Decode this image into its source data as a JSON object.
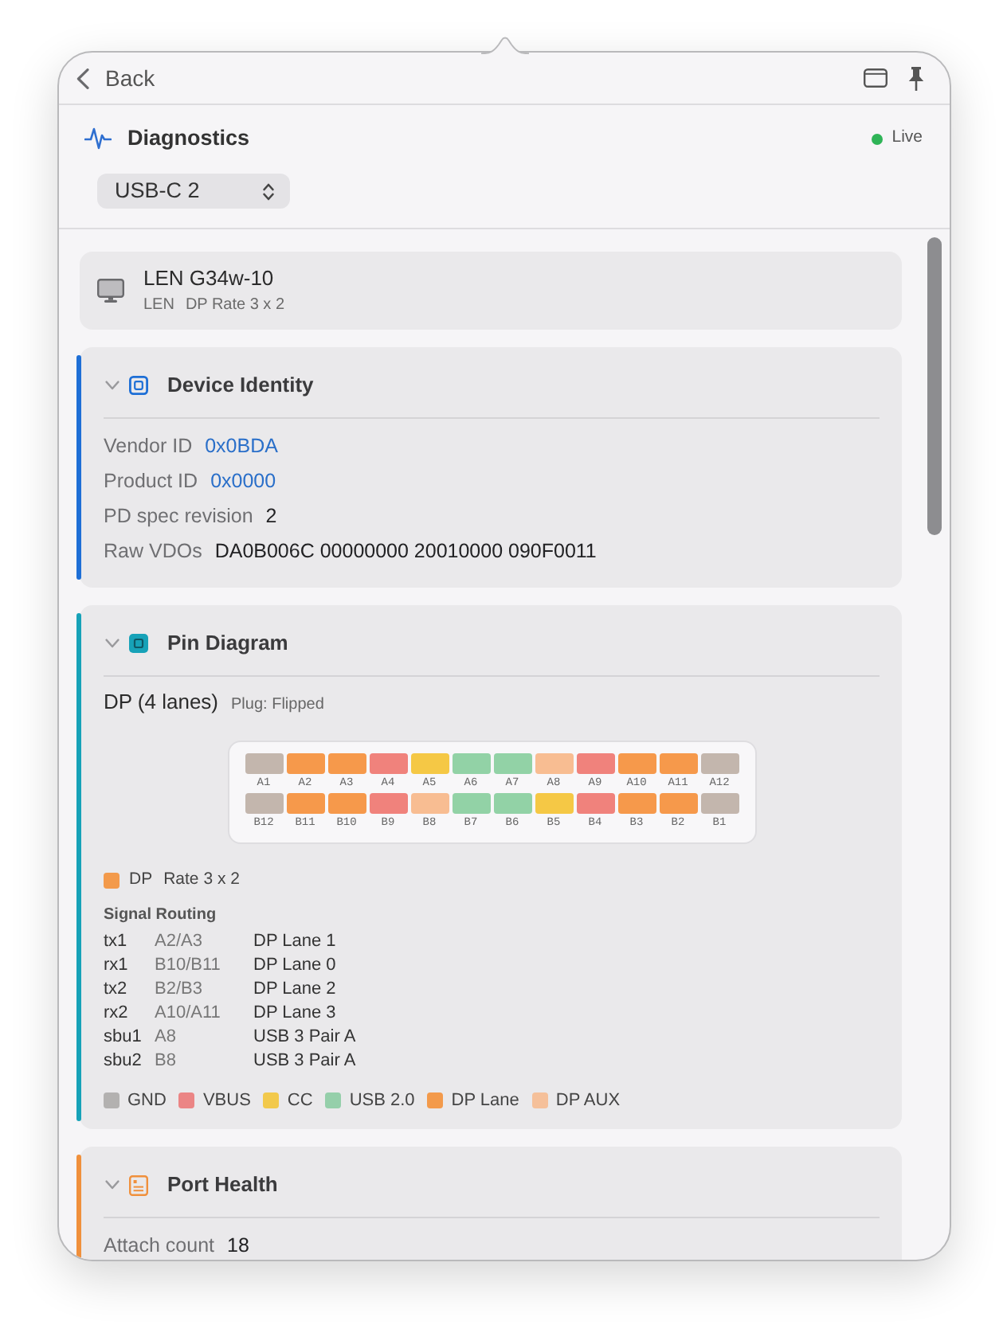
{
  "header": {
    "back_label": "Back"
  },
  "title": "Diagnostics",
  "status": {
    "label": "Live",
    "on": true
  },
  "port_select": {
    "value": "USB-C 2"
  },
  "device": {
    "name": "LEN G34w-10",
    "vendor": "LEN",
    "mode": "DP Rate 3 x 2"
  },
  "sections": [
    {
      "kind": "identity",
      "title": "Device Identity",
      "color": "#1e6fd6",
      "expanded": true,
      "fields": [
        {
          "label": "Vendor ID",
          "value": "0x0BDA",
          "kind": "id"
        },
        {
          "label": "Product ID",
          "value": "0x0000",
          "kind": "id"
        },
        {
          "label": "PD spec revision",
          "value": "2",
          "kind": "plain"
        },
        {
          "label": "Raw VDOs",
          "value": "DA0B006C 00000000 20010000 090F0011",
          "kind": "plain"
        }
      ]
    },
    {
      "kind": "pins",
      "title": "Pin Diagram",
      "color": "#17a2b8",
      "expanded": true,
      "mode": "DP (4 lanes)",
      "plug": "Plug: Flipped",
      "pins_top": [
        {
          "label": "A1",
          "color": "#c3b6ad"
        },
        {
          "label": "A2",
          "color": "#f6994b"
        },
        {
          "label": "A3",
          "color": "#f6994b"
        },
        {
          "label": "A4",
          "color": "#f0827c"
        },
        {
          "label": "A5",
          "color": "#f5c845"
        },
        {
          "label": "A6",
          "color": "#92d2a6"
        },
        {
          "label": "A7",
          "color": "#92d2a6"
        },
        {
          "label": "A8",
          "color": "#f8bd92"
        },
        {
          "label": "A9",
          "color": "#f0827c"
        },
        {
          "label": "A10",
          "color": "#f6994b"
        },
        {
          "label": "A11",
          "color": "#f6994b"
        },
        {
          "label": "A12",
          "color": "#c3b6ad"
        }
      ],
      "pins_bottom": [
        {
          "label": "B12",
          "color": "#c3b6ad"
        },
        {
          "label": "B11",
          "color": "#f6994b"
        },
        {
          "label": "B10",
          "color": "#f6994b"
        },
        {
          "label": "B9",
          "color": "#f0827c"
        },
        {
          "label": "B8",
          "color": "#f8bd92"
        },
        {
          "label": "B7",
          "color": "#92d2a6"
        },
        {
          "label": "B6",
          "color": "#92d2a6"
        },
        {
          "label": "B5",
          "color": "#f5c845"
        },
        {
          "label": "B4",
          "color": "#f0827c"
        },
        {
          "label": "B3",
          "color": "#f6994b"
        },
        {
          "label": "B2",
          "color": "#f6994b"
        },
        {
          "label": "B1",
          "color": "#c3b6ad"
        }
      ],
      "mode_key": {
        "color": "#f39a4b",
        "label": "DP",
        "detail": "Rate 3 x 2"
      },
      "routing_title": "Signal Routing",
      "routing": [
        {
          "signal": "tx1",
          "pins": "A2/A3",
          "function": "DP Lane 1"
        },
        {
          "signal": "rx1",
          "pins": "B10/B11",
          "function": "DP Lane 0"
        },
        {
          "signal": "tx2",
          "pins": "B2/B3",
          "function": "DP Lane 2"
        },
        {
          "signal": "rx2",
          "pins": "A10/A11",
          "function": "DP Lane 3"
        },
        {
          "signal": "sbu1",
          "pins": "A8",
          "function": "USB 3 Pair A"
        },
        {
          "signal": "sbu2",
          "pins": "B8",
          "function": "USB 3 Pair A"
        }
      ],
      "legend": [
        {
          "label": "GND",
          "color": "#b3b1b0"
        },
        {
          "label": "VBUS",
          "color": "#eb8585"
        },
        {
          "label": "CC",
          "color": "#f2c94c"
        },
        {
          "label": "USB 2.0",
          "color": "#95cfaa"
        },
        {
          "label": "DP Lane",
          "color": "#f39a4b"
        },
        {
          "label": "DP AUX",
          "color": "#f5c09a"
        }
      ]
    },
    {
      "kind": "health",
      "title": "Port Health",
      "color": "#f0903c",
      "expanded": true,
      "fields": [
        {
          "label": "Attach count",
          "value": "18",
          "kind": "plain"
        }
      ]
    }
  ]
}
